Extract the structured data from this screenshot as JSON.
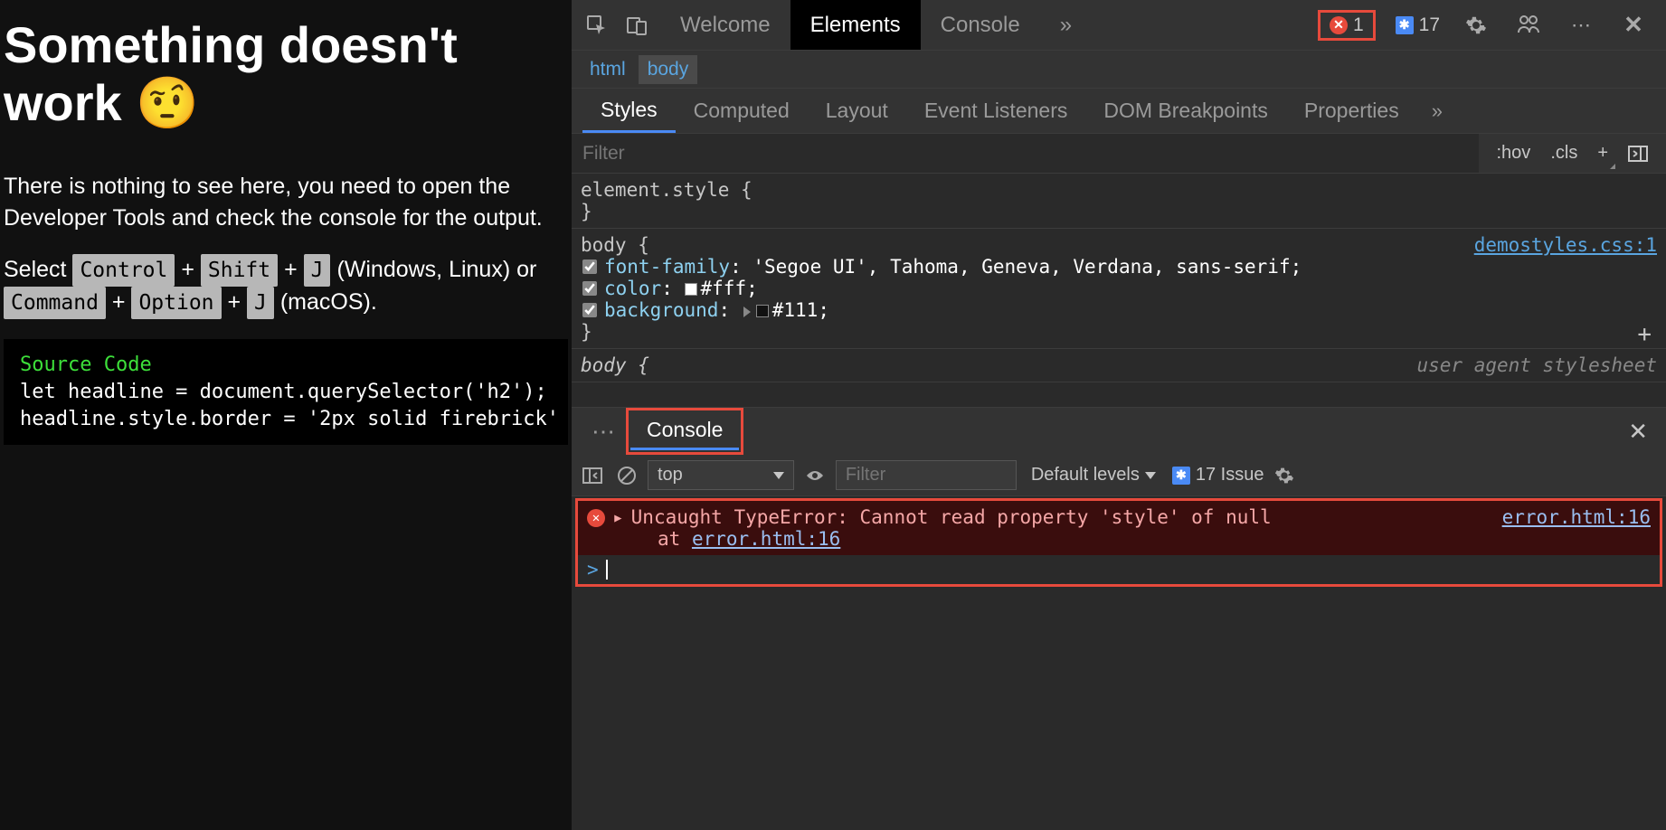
{
  "page": {
    "heading": "Something doesn't work 🤨",
    "p1": "There is nothing to see here, you need to open the Developer Tools and check the console for the output.",
    "p2_prefix": "Select ",
    "kbd_ctrl": "Control",
    "plus": " + ",
    "kbd_shift": "Shift",
    "kbd_j": "J",
    "p2_mid": " (Windows, Linux) or ",
    "kbd_cmd": "Command",
    "kbd_opt": "Option",
    "p2_end": " (macOS).",
    "code_label": "Source Code",
    "code_line1": "let headline = document.querySelector('h2');",
    "code_line2": "headline.style.border = '2px solid firebrick'"
  },
  "devtools": {
    "tabs": {
      "welcome": "Welcome",
      "elements": "Elements",
      "console": "Console",
      "more": "»"
    },
    "errors_count": "1",
    "issues_count": "17",
    "breadcrumb": {
      "html": "html",
      "body": "body"
    },
    "subtabs": {
      "styles": "Styles",
      "computed": "Computed",
      "layout": "Layout",
      "events": "Event Listeners",
      "dom_bp": "DOM Breakpoints",
      "props": "Properties",
      "more": "»"
    },
    "filter_placeholder": "Filter",
    "filter_tools": {
      "hov": ":hov",
      "cls": ".cls",
      "plus": "+"
    },
    "rules": {
      "element_style": "element.style {",
      "close": "}",
      "body_sel": "body {",
      "font_family": {
        "prop": "font-family",
        "val": ": 'Segoe UI', Tahoma, Geneva, Verdana, sans-serif;"
      },
      "color": {
        "prop": "color",
        "val_prefix": ": ",
        "hex": "#fff",
        "suffix": ";"
      },
      "background": {
        "prop": "background",
        "val_prefix": ": ",
        "hex": "#111",
        "suffix": ";"
      },
      "source_link": "demostyles.css:1",
      "ua_label": "user agent stylesheet"
    },
    "drawer": {
      "console_tab": "Console",
      "ctx": "top",
      "filter_placeholder": "Filter",
      "levels": "Default levels",
      "issues_label": "17 Issue",
      "error_text": "Uncaught TypeError: Cannot read property 'style' of null",
      "error_src": "error.html:16",
      "stack_at": "at ",
      "stack_link": "error.html:16",
      "prompt": ">"
    }
  }
}
